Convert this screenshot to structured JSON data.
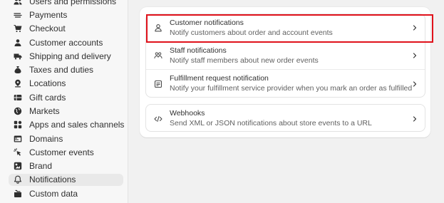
{
  "sidebar": {
    "items": [
      {
        "label": "Users and permissions",
        "icon": "users-icon"
      },
      {
        "label": "Payments",
        "icon": "payments-icon"
      },
      {
        "label": "Checkout",
        "icon": "cart-icon"
      },
      {
        "label": "Customer accounts",
        "icon": "person-icon"
      },
      {
        "label": "Shipping and delivery",
        "icon": "truck-icon"
      },
      {
        "label": "Taxes and duties",
        "icon": "money-bag-icon"
      },
      {
        "label": "Locations",
        "icon": "location-pin-icon"
      },
      {
        "label": "Gift cards",
        "icon": "gift-card-icon"
      },
      {
        "label": "Markets",
        "icon": "globe-icon"
      },
      {
        "label": "Apps and sales channels",
        "icon": "apps-icon"
      },
      {
        "label": "Domains",
        "icon": "domain-icon"
      },
      {
        "label": "Customer events",
        "icon": "cursor-click-icon"
      },
      {
        "label": "Brand",
        "icon": "brand-icon"
      },
      {
        "label": "Notifications",
        "icon": "bell-icon",
        "active": true
      },
      {
        "label": "Custom data",
        "icon": "database-icon"
      }
    ]
  },
  "notifications": {
    "customer": {
      "title": "Customer notifications",
      "desc": "Notify customers about order and account events",
      "icon": "person-icon"
    },
    "staff": {
      "title": "Staff notifications",
      "desc": "Notify staff members about new order events",
      "icon": "staff-icon"
    },
    "fulfillment": {
      "title": "Fulfillment request notification",
      "desc": "Notify your fulfillment service provider when you mark an order as fulfilled",
      "icon": "receipt-icon"
    },
    "webhooks": {
      "title": "Webhooks",
      "desc": "Send XML or JSON notifications about store events to a URL",
      "icon": "code-icon"
    }
  },
  "colors": {
    "highlight": "#e0121b",
    "sidebar_bg": "#f7f7f7",
    "page_bg": "#f1f1f1",
    "active_item_bg": "#e9e9e9"
  }
}
